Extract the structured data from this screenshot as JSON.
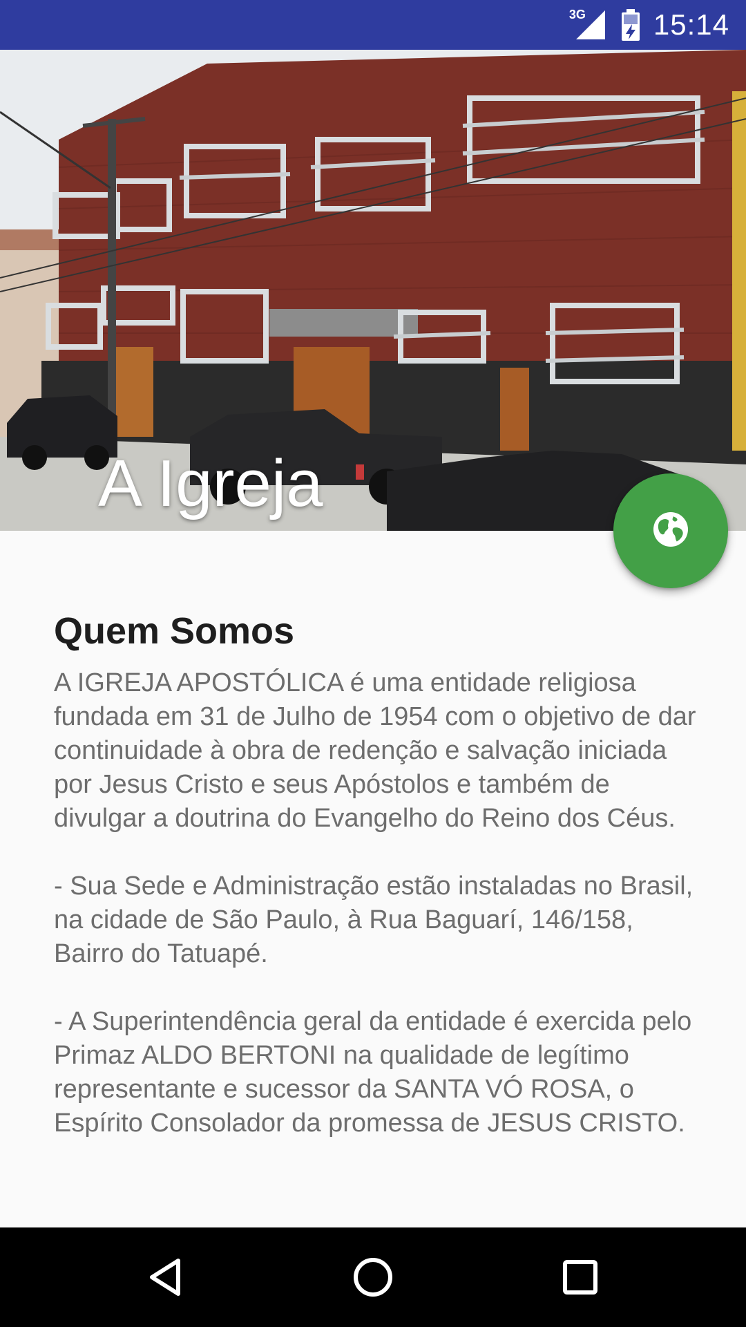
{
  "status_bar": {
    "network_label": "3G",
    "time": "15:14",
    "background": "#2f3c9f"
  },
  "header": {
    "title": "A Igreja",
    "image_description_icon": "church-building-photo"
  },
  "fab": {
    "icon": "globe-icon",
    "color": "#43a047"
  },
  "main": {
    "section_title": "Quem Somos",
    "body": "A IGREJA APOSTÓLICA é uma entidade religiosa fundada em 31 de Julho de 1954 com o objetivo de dar  continuidade à obra de redenção e salvação iniciada por Jesus Cristo e seus Apóstolos e também de  divulgar a doutrina do Evangelho do Reino dos Céus.\n\n - Sua Sede e Administração estão instaladas no Brasil, na cidade de São Paulo, à Rua Baguarí, 146/158,  Bairro do Tatuapé.\n\n - A Superintendência geral da entidade é exercida pelo Primaz ALDO BERTONI na qualidade de legítimo  representante e sucessor da SANTA VÓ ROSA, o Espírito Consolador da promessa de JESUS CRISTO."
  },
  "nav_bar": {
    "back_icon": "back-triangle-icon",
    "home_icon": "home-circle-icon",
    "recents_icon": "recents-square-icon"
  }
}
